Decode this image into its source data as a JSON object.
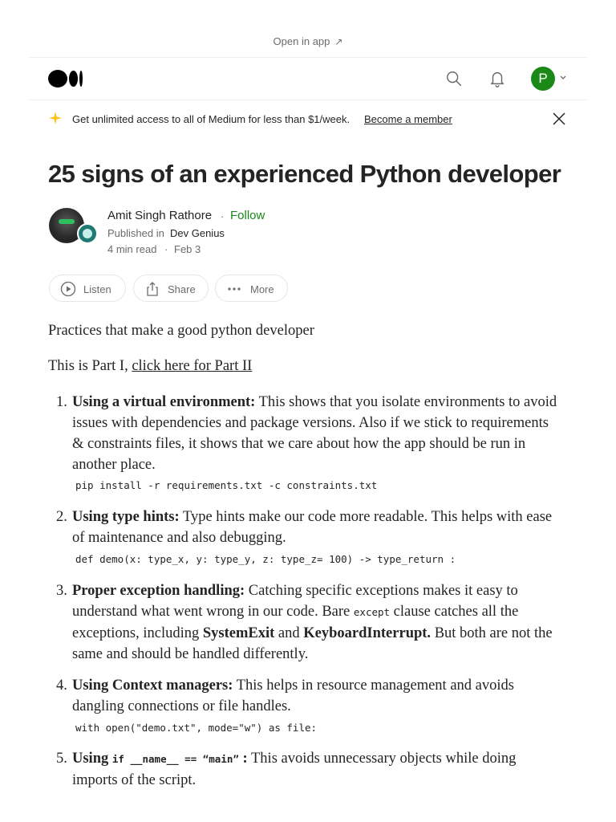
{
  "top": {
    "open_in_app": "Open in app",
    "open_arrow": "↗"
  },
  "header": {
    "avatar_letter": "P",
    "icons": [
      "medium-logo",
      "search-icon",
      "bell-icon",
      "chevron-down-icon"
    ]
  },
  "banner": {
    "text": "Get unlimited access to all of Medium for less than $1/week.",
    "link": "Become a member",
    "accent_color": "#ffc017"
  },
  "article": {
    "title": "25 signs of an experienced Python developer",
    "author": "Amit Singh Rathore",
    "separator": "·",
    "follow": "Follow",
    "published_in": "Published in",
    "publication": "Dev Genius",
    "read_time": "4 min read",
    "date": "Feb 3",
    "actions": {
      "listen": "Listen",
      "share": "Share",
      "more": "More"
    },
    "intro": "Practices that make a good python developer",
    "part_prefix": "This is Part I, ",
    "part_link": "click here for Part II",
    "items": [
      {
        "num": "1.",
        "bold": "Using a virtual environment:",
        "lines": [
          " This shows that you isolate environments to avoid",
          "issues with dependencies and package versions. Also if we stick to requirements",
          "& constraints files, it shows that we care about how the app should be run in",
          "another place."
        ],
        "code": "pip install -r requirements.txt -c constraints.txt"
      },
      {
        "num": "2.",
        "bold": "Using type hints:",
        "lines": [
          " Type hints make our code more readable. This helps with ease",
          "of maintenance and also debugging."
        ],
        "code": "def demo(x: type_x, y: type_y, z: type_z= 100) -> type_return :"
      },
      {
        "num": "3.",
        "bold": "Proper exception handling:",
        "lines": [
          " Catching specific exceptions makes it easy to",
          "understand what went wrong in our code. Bare ",
          "except",
          " clause catches all the",
          "exceptions, including ",
          "SystemExit",
          " and ",
          "KeyboardInterrupt.",
          " But both are not the",
          "same and should be handled differently."
        ]
      },
      {
        "num": "4.",
        "bold": "Using Context managers:",
        "lines": [
          " This helps in resource management and avoids",
          "dangling connections or file handles."
        ],
        "code": "with open(\"demo.txt\", mode=\"w\") as file:"
      },
      {
        "num": "5.",
        "bold": "Using",
        "code_inline": "if __name__ == “main”",
        "bold_after": ":",
        "lines": [
          " This avoids unnecessary objects while doing",
          "imports of the script."
        ]
      }
    ]
  }
}
